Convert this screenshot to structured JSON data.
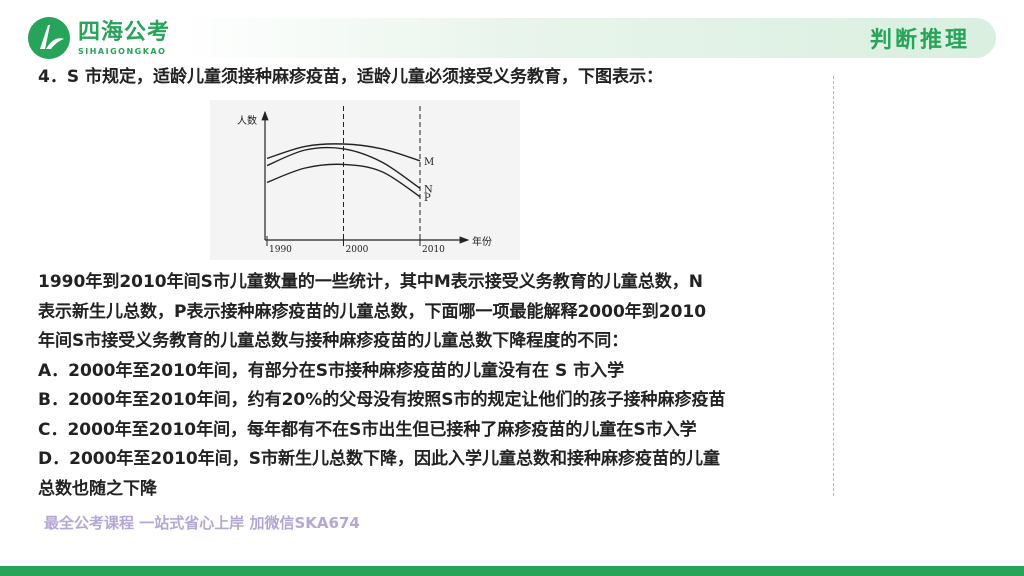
{
  "header": {
    "logo_cn": "四海公考",
    "logo_en": "SIHAIGONGKAO",
    "section_title": "判断推理"
  },
  "question": {
    "stem": "4．S 市规定，适龄儿童须接种麻疹疫苗，适龄儿童必须接受义务教育，下图表示：",
    "body_lines": [
      "1990年到2010年间S市儿童数量的一些统计，其中M表示接受义务教育的儿童总数，N",
      "表示新生儿总数，P表示接种麻疹疫苗的儿童总数，下面哪一项最能解释2000年到2010",
      "年间S市接受义务教育的儿童总数与接种麻疹疫苗的儿童总数下降程度的不同："
    ],
    "options": [
      "A．2000年至2010年间，有部分在S市接种麻疹疫苗的儿童没有在 S 市入学",
      "B．2000年至2010年间，约有20%的父母没有按照S市的规定让他们的孩子接种麻疹疫苗",
      "C．2000年至2010年间，每年都有不在S市出生但已接种了麻疹疫苗的儿童在S市入学",
      "D．2000年至2010年间，S市新生儿总数下降，因此入学儿童总数和接种麻疹疫苗的儿童",
      "总数也随之下降"
    ]
  },
  "watermark": "最全公考课程 一站式省心上岸 加微信SKA674",
  "chart_data": {
    "type": "line",
    "ylabel": "人数",
    "xlabel": "年份",
    "x_ticks": [
      "1990",
      "2000",
      "2010"
    ],
    "x": [
      1990,
      1995,
      2000,
      2005,
      2010
    ],
    "ylim": [
      0,
      100
    ],
    "reference_lines": [
      2000,
      2010
    ],
    "series": [
      {
        "name": "M",
        "values": [
          68,
          78,
          80,
          76,
          66
        ]
      },
      {
        "name": "N",
        "values": [
          62,
          75,
          76,
          65,
          43
        ]
      },
      {
        "name": "P",
        "values": [
          48,
          60,
          63,
          57,
          36
        ]
      }
    ]
  },
  "colors": {
    "brand": "#27a35a",
    "line": "#222222"
  }
}
